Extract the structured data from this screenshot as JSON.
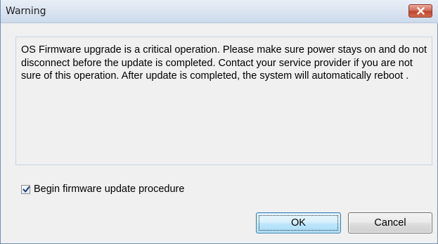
{
  "window": {
    "title": "Warning",
    "close_icon": "close-icon"
  },
  "message": {
    "text": "OS Firmware upgrade is a critical operation. Please make sure power stays on and do not disconnect before the update is completed. Contact your service provider if you are not sure of this operation. After update is completed, the system will automatically reboot ."
  },
  "checkbox": {
    "label": "Begin firmware update procedure",
    "checked": true
  },
  "buttons": {
    "ok_label": "OK",
    "cancel_label": "Cancel"
  },
  "colors": {
    "close_button": "#c7482f",
    "titlebar": "#dbe5f1",
    "dialog_bg": "#f0f0f0",
    "ok_button_border": "#3c7fb1"
  }
}
